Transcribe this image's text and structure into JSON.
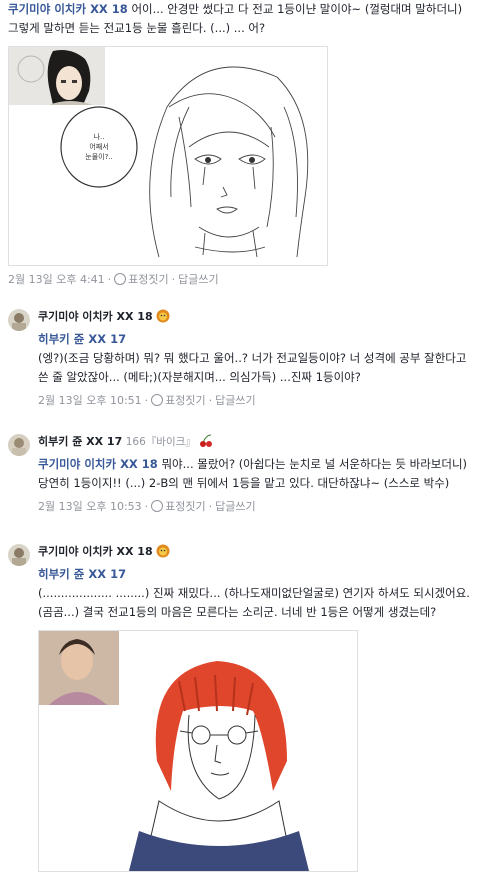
{
  "comment1": {
    "author": "쿠기미야 이치카 XX 18",
    "text": " 어이... 안경만 썼다고 다 전교 1등이냔 말이야~ (껄렁대며 말하더니) 그렇게 말하면 듣는 전교1등 눈물 흘린다. (...) ... 어?",
    "bubble_line1": "나..",
    "bubble_line2": "어째서",
    "bubble_line3": "눈물이?..",
    "date": "2월 13일 오후 4:41",
    "react": "표정짓기",
    "reply": "답글쓰기"
  },
  "reply1": {
    "author": "쿠기미야 이치카 XX 18",
    "mention": "히부키 쥰 XX 17",
    "text": "(엥?)(조금 당황하며) 뭐? 뭐 했다고 울어..? 너가 전교일등이야? 너 성격에 공부 잘한다고 쓴 줄 알았잖아... (메타;)(자분해지며... 의심가득) ...진짜 1등이야?",
    "date": "2월 13일 오후 10:51",
    "react": "표정짓기",
    "reply": "답글쓰기"
  },
  "reply2": {
    "author": "히부키 쥰 XX 17",
    "extra": "166『바이크』",
    "mention": "쿠기미야 이치카 XX 18",
    "text": " 뭐야... 몰랐어? (아쉽다는 눈치로 널 서운하다는 듯 바라보더니) 당연히 1등이지!! (...) 2-B의 맨 뒤에서 1등을 맡고 있다. 대단하잖냐~ (스스로 박수)",
    "date": "2월 13일 오후 10:53",
    "react": "표정짓기",
    "reply": "답글쓰기"
  },
  "reply3": {
    "author": "쿠기미야 이치카 XX 18",
    "mention": "히부키 쥰 XX 17",
    "text": "(................... ........) 진짜 재밌다... (하나도재미없단얼굴로) 연기자 하셔도 되시겠어요. (곰곰...) 결국 전교1등의 마음은 모른다는 소리군. 너네 반 1등은 어떻게 생겼는데?"
  },
  "colors": {
    "link": "#385898",
    "meta": "#90949c",
    "text": "#1d2129"
  },
  "icons": [
    "smile-icon",
    "lion-emoji",
    "cherry-emoji"
  ]
}
